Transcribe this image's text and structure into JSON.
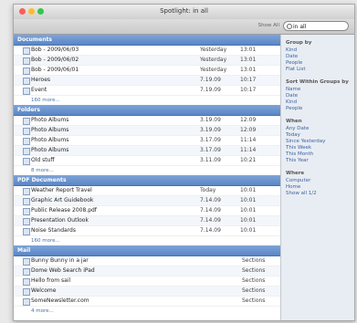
{
  "window": {
    "title": "Spotlight: in all"
  },
  "toolbar": {
    "hint": "Show All",
    "search_value": "in all"
  },
  "sections": [
    {
      "title": "Documents",
      "rows": [
        {
          "name": "Bob - 2009/06/03",
          "date": "Yesterday",
          "time": "13:01"
        },
        {
          "name": "Bob - 2009/06/02",
          "date": "Yesterday",
          "time": "13:01"
        },
        {
          "name": "Bob - 2009/06/01",
          "date": "Yesterday",
          "time": "13:01"
        },
        {
          "name": "Heroes",
          "date": "7.19.09",
          "time": "10:17"
        },
        {
          "name": "Event",
          "date": "7.19.09",
          "time": "10:17"
        }
      ],
      "more": "160 more..."
    },
    {
      "title": "Folders",
      "rows": [
        {
          "name": "Photo Albums",
          "date": "3.19.09",
          "time": "12:09"
        },
        {
          "name": "Photo Albums",
          "date": "3.19.09",
          "time": "12:09"
        },
        {
          "name": "Photo Albums",
          "date": "3.17.09",
          "time": "11:14"
        },
        {
          "name": "Photo Albums",
          "date": "3.17.09",
          "time": "11:14"
        },
        {
          "name": "Old stuff",
          "date": "3.11.09",
          "time": "10:21"
        }
      ],
      "more": "8 more..."
    },
    {
      "title": "PDF Documents",
      "rows": [
        {
          "name": "Weather Report Travel",
          "date": "Today",
          "time": "10:01"
        },
        {
          "name": "Graphic Art Guidebook",
          "date": "7.14.09",
          "time": "10:01"
        },
        {
          "name": "Public Release 2008.pdf",
          "date": "7.14.09",
          "time": "10:01"
        },
        {
          "name": "Presentation Outlook",
          "date": "7.14.09",
          "time": "10:01"
        },
        {
          "name": "Noise Standards",
          "date": "7.14.09",
          "time": "10:01"
        }
      ],
      "more": "160 more..."
    },
    {
      "title": "Mail",
      "rows": [
        {
          "name": "Bunny Bunny in a jar",
          "kind": "Sections"
        },
        {
          "name": "Dome Web Search iPad",
          "kind": "Sections"
        },
        {
          "name": "Hello from sail",
          "kind": "Sections"
        },
        {
          "name": "Welcome",
          "kind": "Sections"
        },
        {
          "name": "SomeNewsletter.com",
          "kind": "Sections"
        }
      ],
      "more": "4 more..."
    }
  ],
  "sidebar": {
    "groups": [
      {
        "title": "Group by",
        "items": [
          "Kind",
          "Date",
          "People",
          "Flat List"
        ]
      },
      {
        "title": "Sort Within Groups by",
        "items": [
          "Name",
          "Date",
          "Kind",
          "People"
        ]
      },
      {
        "title": "When",
        "items": [
          "Any Date",
          "Today",
          "Since Yesterday",
          "This Week",
          "This Month",
          "This Year"
        ]
      },
      {
        "title": "Where",
        "items": [
          "Computer",
          "Home",
          "Show all 1/2"
        ]
      }
    ]
  },
  "colors": {
    "close": "#fc5f57",
    "minimize": "#fdbc2e",
    "zoom": "#33c748",
    "header": "#5a86c6"
  }
}
